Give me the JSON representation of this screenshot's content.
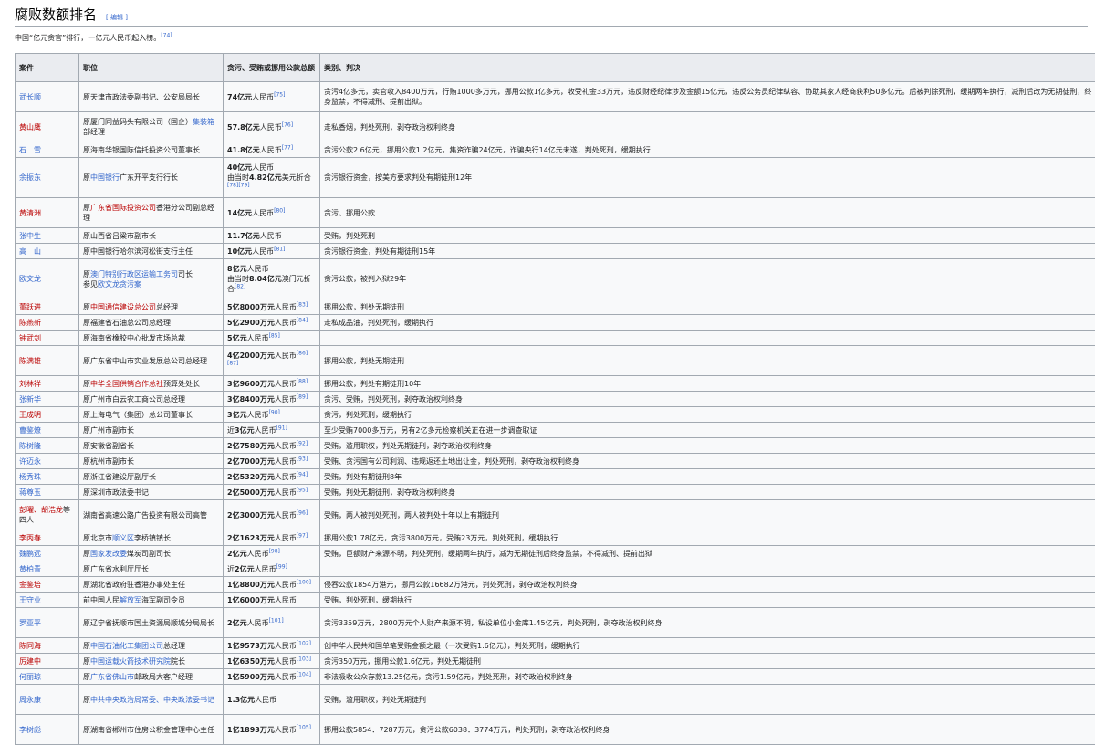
{
  "section": {
    "title": "腐败数额排名",
    "edit_label": "[ 编辑 ]",
    "intro": "中国“亿元贪官”排行，一亿元人民币起入榜。",
    "intro_ref": "[74]"
  },
  "table": {
    "headers": [
      "案件",
      "职位",
      "贪污、受贿或挪用公款总额",
      "类别、判决"
    ],
    "rows": [
      {
        "name": "武长顺",
        "pos": "原天津市政法委副书记、公安局局长",
        "amount": "74亿元",
        "unit": "人民币",
        "ref": "[75]",
        "verdict": "贪污4亿多元，卖官收入8400万元，行贿1000多万元，挪用公款1亿多元，收受礼金33万元，违反财经纪律涉及金额15亿元，违反公务员纪律纵容、协助其家人经商获利50多亿元。后被判除死刑，缓期两年执行，减刑后改为无期徒刑，终身监禁，不得减刑、提前出狱。"
      },
      {
        "name": "黄山鹰",
        "pos": "原厦门同益码头有限公司（国企）",
        "pos_link": "集装箱",
        "pos_after": "部经理",
        "amount": "57.8亿元",
        "unit": "人民币",
        "ref": "[76]",
        "verdict": "走私香烟，判处死刑，剥夺政治权利终身"
      },
      {
        "name": "石　雪",
        "pos": "原海南华银国际信托投资公司董事长",
        "amount": "41.8亿元",
        "unit": "人民币",
        "ref": "[77]",
        "verdict": "贪污公款2.6亿元，挪用公款1.2亿元，集资诈骗24亿元，诈骗央行14亿元未遂，判处死刑，缓期执行"
      },
      {
        "name": "余振东",
        "pos_pre": "原",
        "pos_link": "中国银行",
        "pos_after": "广东开平支行行长",
        "amount": "40亿元",
        "unit": "人民币",
        "amount2": "由当时",
        "amount2_b": "4.82亿元",
        "amount2_tail": "美元折合",
        "ref": "[78][79]",
        "verdict": "贪污银行资金，按美方要求判处有期徒刑12年"
      },
      {
        "name": "黄清洲",
        "pos_pre": "原",
        "pos_link": "广东省国际投资公司",
        "pos_after": "香港分公司副总经理",
        "amount": "14亿元",
        "unit": "人民币",
        "ref": "[80]",
        "verdict": "贪污、挪用公款"
      },
      {
        "name": "张中生",
        "pos": "原山西省吕梁市副市长",
        "amount": "11.7亿元",
        "unit": "人民币",
        "ref": "",
        "verdict": "受贿，判处死刑"
      },
      {
        "name": "高　山",
        "pos": "原中国银行哈尔滨河松街支行主任",
        "amount": "10亿元",
        "unit": "人民币",
        "ref": "[81]",
        "verdict": "贪污银行资金，判处有期徒刑15年"
      },
      {
        "name": "欧文龙",
        "pos_pre": "原",
        "pos_link": "澳门特别行政区运输工务司",
        "pos_after": "司长",
        "pos_line2": "参见",
        "pos_link2": "欧文龙贪污案",
        "amount": "8亿元",
        "unit": "人民币",
        "amount2": "由当时",
        "amount2_b": "8.04亿元",
        "amount2_tail": "澳门元折合",
        "ref": "[82]",
        "verdict": "贪污公款，被判入狱29年"
      },
      {
        "name": "董跃进",
        "pos_pre": "原",
        "pos_link": "中国通信建设总公司",
        "pos_after": "总经理",
        "amount": "5亿8000万元",
        "unit": "人民币",
        "ref": "[83]",
        "verdict": "挪用公款，判处无期徒刑"
      },
      {
        "name": "陈燕新",
        "pos": "原福建省石油总公司总经理",
        "amount": "5亿2900万元",
        "unit": "人民币",
        "ref": "[84]",
        "verdict": "走私成品油，判处死刑，缓期执行"
      },
      {
        "name": "钟武剑",
        "pos": "原海南省橡胶中心批发市场总裁",
        "amount": "5亿元",
        "unit": "人民币",
        "ref": "[85]",
        "verdict": ""
      },
      {
        "name": "陈满雄",
        "pos": "原广东省中山市实业发展总公司总经理",
        "amount": "4亿2000万元",
        "unit": "人民币",
        "ref": "[86][87]",
        "verdict": "挪用公款，判处无期徒刑"
      },
      {
        "name": "刘林祥",
        "pos_pre": "原",
        "pos_link": "中华全国供销合作总社",
        "pos_after": "预算处处长",
        "amount": "3亿9600万元",
        "unit": "人民币",
        "ref": "[88]",
        "verdict": "挪用公款，判处有期徒刑10年"
      },
      {
        "name": "张新华",
        "pos": "原广州市白云农工商公司总经理",
        "amount": "3亿8400万元",
        "unit": "人民币",
        "ref": "[89]",
        "verdict": "贪污、受贿，判处死刑，剥夺政治权利终身"
      },
      {
        "name": "王成明",
        "pos": "原上海电气（集团）总公司董事长",
        "amount": "3亿元",
        "unit": "人民币",
        "ref": "[90]",
        "verdict": "贪污，判处死刑，缓期执行"
      },
      {
        "name": "曹鉴燎",
        "pos": "原广州市副市长",
        "amount_pre": "近",
        "amount": "3亿元",
        "unit": "人民币",
        "ref": "[91]",
        "verdict": "至少受贿7000多万元，另有2亿多元检察机关正在进一步调查取证"
      },
      {
        "name": "陈树隆",
        "pos": "原安徽省副省长",
        "amount": "2亿7580万元",
        "unit": "人民币",
        "ref": "[92]",
        "verdict": "受贿，滥用职权，判处无期徒刑，剥夺政治权利终身"
      },
      {
        "name": "许迈永",
        "pos": "原杭州市副市长",
        "amount": "2亿7000万元",
        "unit": "人民币",
        "ref": "[93]",
        "verdict": "受贿、贪污国有公司利润、违规返还土地出让金，判处死刑，剥夺政治权利终身"
      },
      {
        "name": "杨秀珠",
        "pos": "原浙江省建设厅副厅长",
        "amount": "2亿5320万元",
        "unit": "人民币",
        "ref": "[94]",
        "verdict": "受贿，判处有期徒刑8年"
      },
      {
        "name": "蒋尊玉",
        "pos": "原深圳市政法委书记",
        "amount": "2亿5000万元",
        "unit": "人民币",
        "ref": "[95]",
        "verdict": "受贿，判处无期徒刑，剥夺政治权利终身"
      },
      {
        "name": "彭曜、胡浩龙",
        "name_tail": "等四人",
        "pos": "湖南省高速公路广告投资有限公司高管",
        "amount": "2亿3000万元",
        "unit": "人民币",
        "ref": "[96]",
        "verdict": "受贿，两人被判处死刑，两人被判处十年以上有期徒刑"
      },
      {
        "name": "李丙春",
        "pos_pre": "原北京市",
        "pos_link": "顺义区",
        "pos_after": "李桥镇镇长",
        "amount": "2亿1623万元",
        "unit": "人民币",
        "ref": "[97]",
        "verdict": "挪用公款1.78亿元，贪污3800万元，受贿23万元，判处死刑，缓期执行"
      },
      {
        "name": "魏鹏远",
        "pos_pre": "原",
        "pos_link": "国家发改委",
        "pos_after": "煤炭司副司长",
        "amount": "2亿元",
        "unit": "人民币",
        "ref": "[98]",
        "verdict": "受贿，巨额财产来源不明，判处死刑，缓期两年执行，减为无期徒刑后终身监禁，不得减刑、提前出狱"
      },
      {
        "name": "黄柏青",
        "pos": "原广东省水利厅厅长",
        "amount_pre": "近",
        "amount": "2亿元",
        "unit": "人民币",
        "ref": "[99]",
        "verdict": ""
      },
      {
        "name": "金鉴培",
        "pos": "原湖北省政府驻香港办事处主任",
        "amount": "1亿8800万元",
        "unit": "人民币",
        "ref": "[100]",
        "verdict": "侵吞公款1854万港元，挪用公款16682万港元，判处死刑，剥夺政治权利终身"
      },
      {
        "name": "王守业",
        "pos_pre": "前中国人民",
        "pos_link": "解放军",
        "pos_after": "海军副司令员",
        "amount": "1亿6000万元",
        "unit": "人民币",
        "ref": "",
        "verdict": "受贿，判处死刑，缓期执行"
      },
      {
        "name": "罗亚平",
        "pos": "原辽宁省抚顺市国土资源局顺城分局局长",
        "amount": "2亿元",
        "unit": "人民币",
        "ref": "[101]",
        "verdict": "贪污3359万元，2800万元个人财产来源不明，私设单位小金库1.45亿元，判处死刑，剥夺政治权利终身"
      },
      {
        "name": "陈同海",
        "pos_pre": "原",
        "pos_link": "中国石油化工集团公司",
        "pos_after": "总经理",
        "amount": "1亿9573万元",
        "unit": "人民币",
        "ref": "[102]",
        "verdict": "创中华人民共和国单笔受贿金额之最（一次受贿1.6亿元），判处死刑，缓期执行"
      },
      {
        "name": "厉建中",
        "pos_pre": "原",
        "pos_link": "中国运载火箭技术研究院",
        "pos_after": "院长",
        "amount": "1亿6350万元",
        "unit": "人民币",
        "ref": "[103]",
        "verdict": "贪污350万元，挪用公款1.6亿元，判处无期徒刑"
      },
      {
        "name": "何丽琼",
        "pos_pre": "原",
        "pos_link": "广东省佛山市",
        "pos_after": "邮政局大客户经理",
        "amount": "1亿5900万元",
        "unit": "人民币",
        "ref": "[104]",
        "verdict": "非法吸收公众存款13.25亿元，贪污1.59亿元，判处死刑，剥夺政治权利终身"
      },
      {
        "name": "周永康",
        "pos_pre": "原",
        "pos_link": "中共中央政治局常委、中央政法委书记",
        "pos_after": "",
        "amount": "1.3亿元",
        "unit": "人民币",
        "ref": "",
        "verdict": "受贿，滥用职权，判处无期徒刑"
      },
      {
        "name": "李树彪",
        "pos": "原湖南省郴州市住房公积金管理中心主任",
        "amount": "1亿1893万元",
        "unit": "人民币",
        "ref": "[105]",
        "verdict": "挪用公款5854．7287万元，贪污公款6038．3774万元，判处死刑，剥夺政治权利终身"
      }
    ]
  },
  "colors": {
    "link": "#3366cc",
    "redlink": "#ba0000",
    "header_bg": "#eaecf0",
    "row_bg": "#f8f9fa",
    "border": "#a2a9b1"
  }
}
